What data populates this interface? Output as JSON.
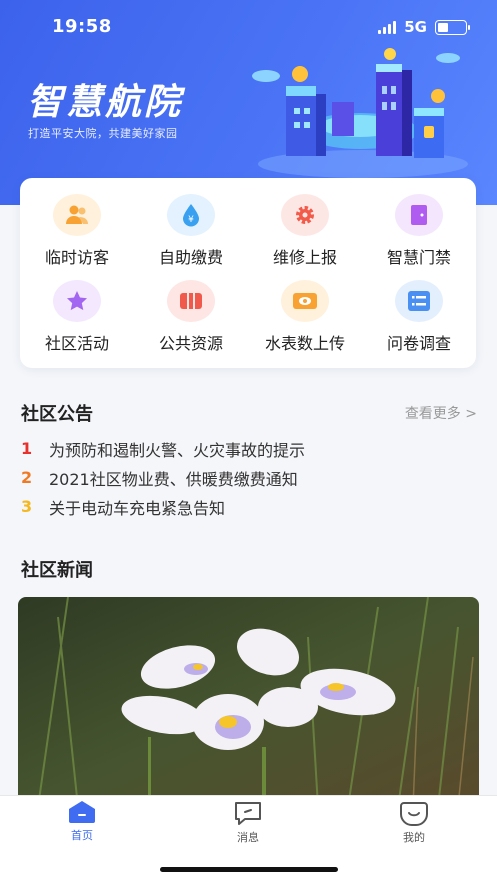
{
  "status_bar": {
    "time": "19:58",
    "network": "5G"
  },
  "header": {
    "title": "智慧航院",
    "slogan": "打造平安大院，共建美好家园"
  },
  "services": [
    {
      "label": "临时访客",
      "icon": "visitor-icon",
      "color": "#f7a233",
      "bg": "#fff1dc"
    },
    {
      "label": "自助缴费",
      "icon": "payment-icon",
      "color": "#3aa0f0",
      "bg": "#e3f2fe"
    },
    {
      "label": "维修上报",
      "icon": "repair-icon",
      "color": "#f25a4a",
      "bg": "#fde7e4"
    },
    {
      "label": "智慧门禁",
      "icon": "door-icon",
      "color": "#b15cf0",
      "bg": "#f4e6fd"
    },
    {
      "label": "社区活动",
      "icon": "star-icon",
      "color": "#a366f0",
      "bg": "#f3e8fd"
    },
    {
      "label": "公共资源",
      "icon": "map-icon",
      "color": "#f05a4c",
      "bg": "#fde6e3"
    },
    {
      "label": "水表数上传",
      "icon": "meter-icon",
      "color": "#f7a233",
      "bg": "#fff1dc"
    },
    {
      "label": "问卷调查",
      "icon": "list-icon",
      "color": "#4a8ff2",
      "bg": "#e4effe"
    }
  ],
  "announcements": {
    "title": "社区公告",
    "more": "查看更多 >",
    "items": [
      {
        "num": "1",
        "text": "为预防和遏制火警、火灾事故的提示",
        "color": "#e8302c"
      },
      {
        "num": "2",
        "text": "2021社区物业费、供暖费缴费通知",
        "color": "#f07a23"
      },
      {
        "num": "3",
        "text": "关于电动车充电紧急告知",
        "color": "#f5b820"
      }
    ]
  },
  "news": {
    "title": "社区新闻"
  },
  "tabs": [
    {
      "label": "首页",
      "icon": "home-icon",
      "active": true
    },
    {
      "label": "消息",
      "icon": "message-icon",
      "active": false
    },
    {
      "label": "我的",
      "icon": "profile-icon",
      "active": false
    }
  ]
}
